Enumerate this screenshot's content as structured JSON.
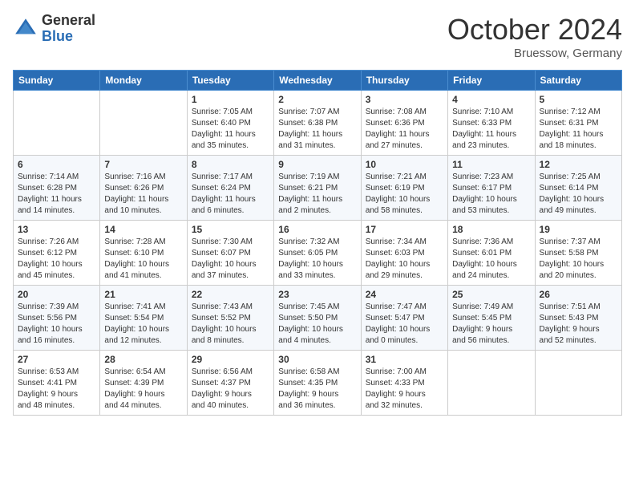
{
  "logo": {
    "general": "General",
    "blue": "Blue"
  },
  "header": {
    "month": "October 2024",
    "location": "Bruessow, Germany"
  },
  "weekdays": [
    "Sunday",
    "Monday",
    "Tuesday",
    "Wednesday",
    "Thursday",
    "Friday",
    "Saturday"
  ],
  "weeks": [
    [
      {
        "day": "",
        "info": ""
      },
      {
        "day": "",
        "info": ""
      },
      {
        "day": "1",
        "info": "Sunrise: 7:05 AM\nSunset: 6:40 PM\nDaylight: 11 hours\nand 35 minutes."
      },
      {
        "day": "2",
        "info": "Sunrise: 7:07 AM\nSunset: 6:38 PM\nDaylight: 11 hours\nand 31 minutes."
      },
      {
        "day": "3",
        "info": "Sunrise: 7:08 AM\nSunset: 6:36 PM\nDaylight: 11 hours\nand 27 minutes."
      },
      {
        "day": "4",
        "info": "Sunrise: 7:10 AM\nSunset: 6:33 PM\nDaylight: 11 hours\nand 23 minutes."
      },
      {
        "day": "5",
        "info": "Sunrise: 7:12 AM\nSunset: 6:31 PM\nDaylight: 11 hours\nand 18 minutes."
      }
    ],
    [
      {
        "day": "6",
        "info": "Sunrise: 7:14 AM\nSunset: 6:28 PM\nDaylight: 11 hours\nand 14 minutes."
      },
      {
        "day": "7",
        "info": "Sunrise: 7:16 AM\nSunset: 6:26 PM\nDaylight: 11 hours\nand 10 minutes."
      },
      {
        "day": "8",
        "info": "Sunrise: 7:17 AM\nSunset: 6:24 PM\nDaylight: 11 hours\nand 6 minutes."
      },
      {
        "day": "9",
        "info": "Sunrise: 7:19 AM\nSunset: 6:21 PM\nDaylight: 11 hours\nand 2 minutes."
      },
      {
        "day": "10",
        "info": "Sunrise: 7:21 AM\nSunset: 6:19 PM\nDaylight: 10 hours\nand 58 minutes."
      },
      {
        "day": "11",
        "info": "Sunrise: 7:23 AM\nSunset: 6:17 PM\nDaylight: 10 hours\nand 53 minutes."
      },
      {
        "day": "12",
        "info": "Sunrise: 7:25 AM\nSunset: 6:14 PM\nDaylight: 10 hours\nand 49 minutes."
      }
    ],
    [
      {
        "day": "13",
        "info": "Sunrise: 7:26 AM\nSunset: 6:12 PM\nDaylight: 10 hours\nand 45 minutes."
      },
      {
        "day": "14",
        "info": "Sunrise: 7:28 AM\nSunset: 6:10 PM\nDaylight: 10 hours\nand 41 minutes."
      },
      {
        "day": "15",
        "info": "Sunrise: 7:30 AM\nSunset: 6:07 PM\nDaylight: 10 hours\nand 37 minutes."
      },
      {
        "day": "16",
        "info": "Sunrise: 7:32 AM\nSunset: 6:05 PM\nDaylight: 10 hours\nand 33 minutes."
      },
      {
        "day": "17",
        "info": "Sunrise: 7:34 AM\nSunset: 6:03 PM\nDaylight: 10 hours\nand 29 minutes."
      },
      {
        "day": "18",
        "info": "Sunrise: 7:36 AM\nSunset: 6:01 PM\nDaylight: 10 hours\nand 24 minutes."
      },
      {
        "day": "19",
        "info": "Sunrise: 7:37 AM\nSunset: 5:58 PM\nDaylight: 10 hours\nand 20 minutes."
      }
    ],
    [
      {
        "day": "20",
        "info": "Sunrise: 7:39 AM\nSunset: 5:56 PM\nDaylight: 10 hours\nand 16 minutes."
      },
      {
        "day": "21",
        "info": "Sunrise: 7:41 AM\nSunset: 5:54 PM\nDaylight: 10 hours\nand 12 minutes."
      },
      {
        "day": "22",
        "info": "Sunrise: 7:43 AM\nSunset: 5:52 PM\nDaylight: 10 hours\nand 8 minutes."
      },
      {
        "day": "23",
        "info": "Sunrise: 7:45 AM\nSunset: 5:50 PM\nDaylight: 10 hours\nand 4 minutes."
      },
      {
        "day": "24",
        "info": "Sunrise: 7:47 AM\nSunset: 5:47 PM\nDaylight: 10 hours\nand 0 minutes."
      },
      {
        "day": "25",
        "info": "Sunrise: 7:49 AM\nSunset: 5:45 PM\nDaylight: 9 hours\nand 56 minutes."
      },
      {
        "day": "26",
        "info": "Sunrise: 7:51 AM\nSunset: 5:43 PM\nDaylight: 9 hours\nand 52 minutes."
      }
    ],
    [
      {
        "day": "27",
        "info": "Sunrise: 6:53 AM\nSunset: 4:41 PM\nDaylight: 9 hours\nand 48 minutes."
      },
      {
        "day": "28",
        "info": "Sunrise: 6:54 AM\nSunset: 4:39 PM\nDaylight: 9 hours\nand 44 minutes."
      },
      {
        "day": "29",
        "info": "Sunrise: 6:56 AM\nSunset: 4:37 PM\nDaylight: 9 hours\nand 40 minutes."
      },
      {
        "day": "30",
        "info": "Sunrise: 6:58 AM\nSunset: 4:35 PM\nDaylight: 9 hours\nand 36 minutes."
      },
      {
        "day": "31",
        "info": "Sunrise: 7:00 AM\nSunset: 4:33 PM\nDaylight: 9 hours\nand 32 minutes."
      },
      {
        "day": "",
        "info": ""
      },
      {
        "day": "",
        "info": ""
      }
    ]
  ]
}
